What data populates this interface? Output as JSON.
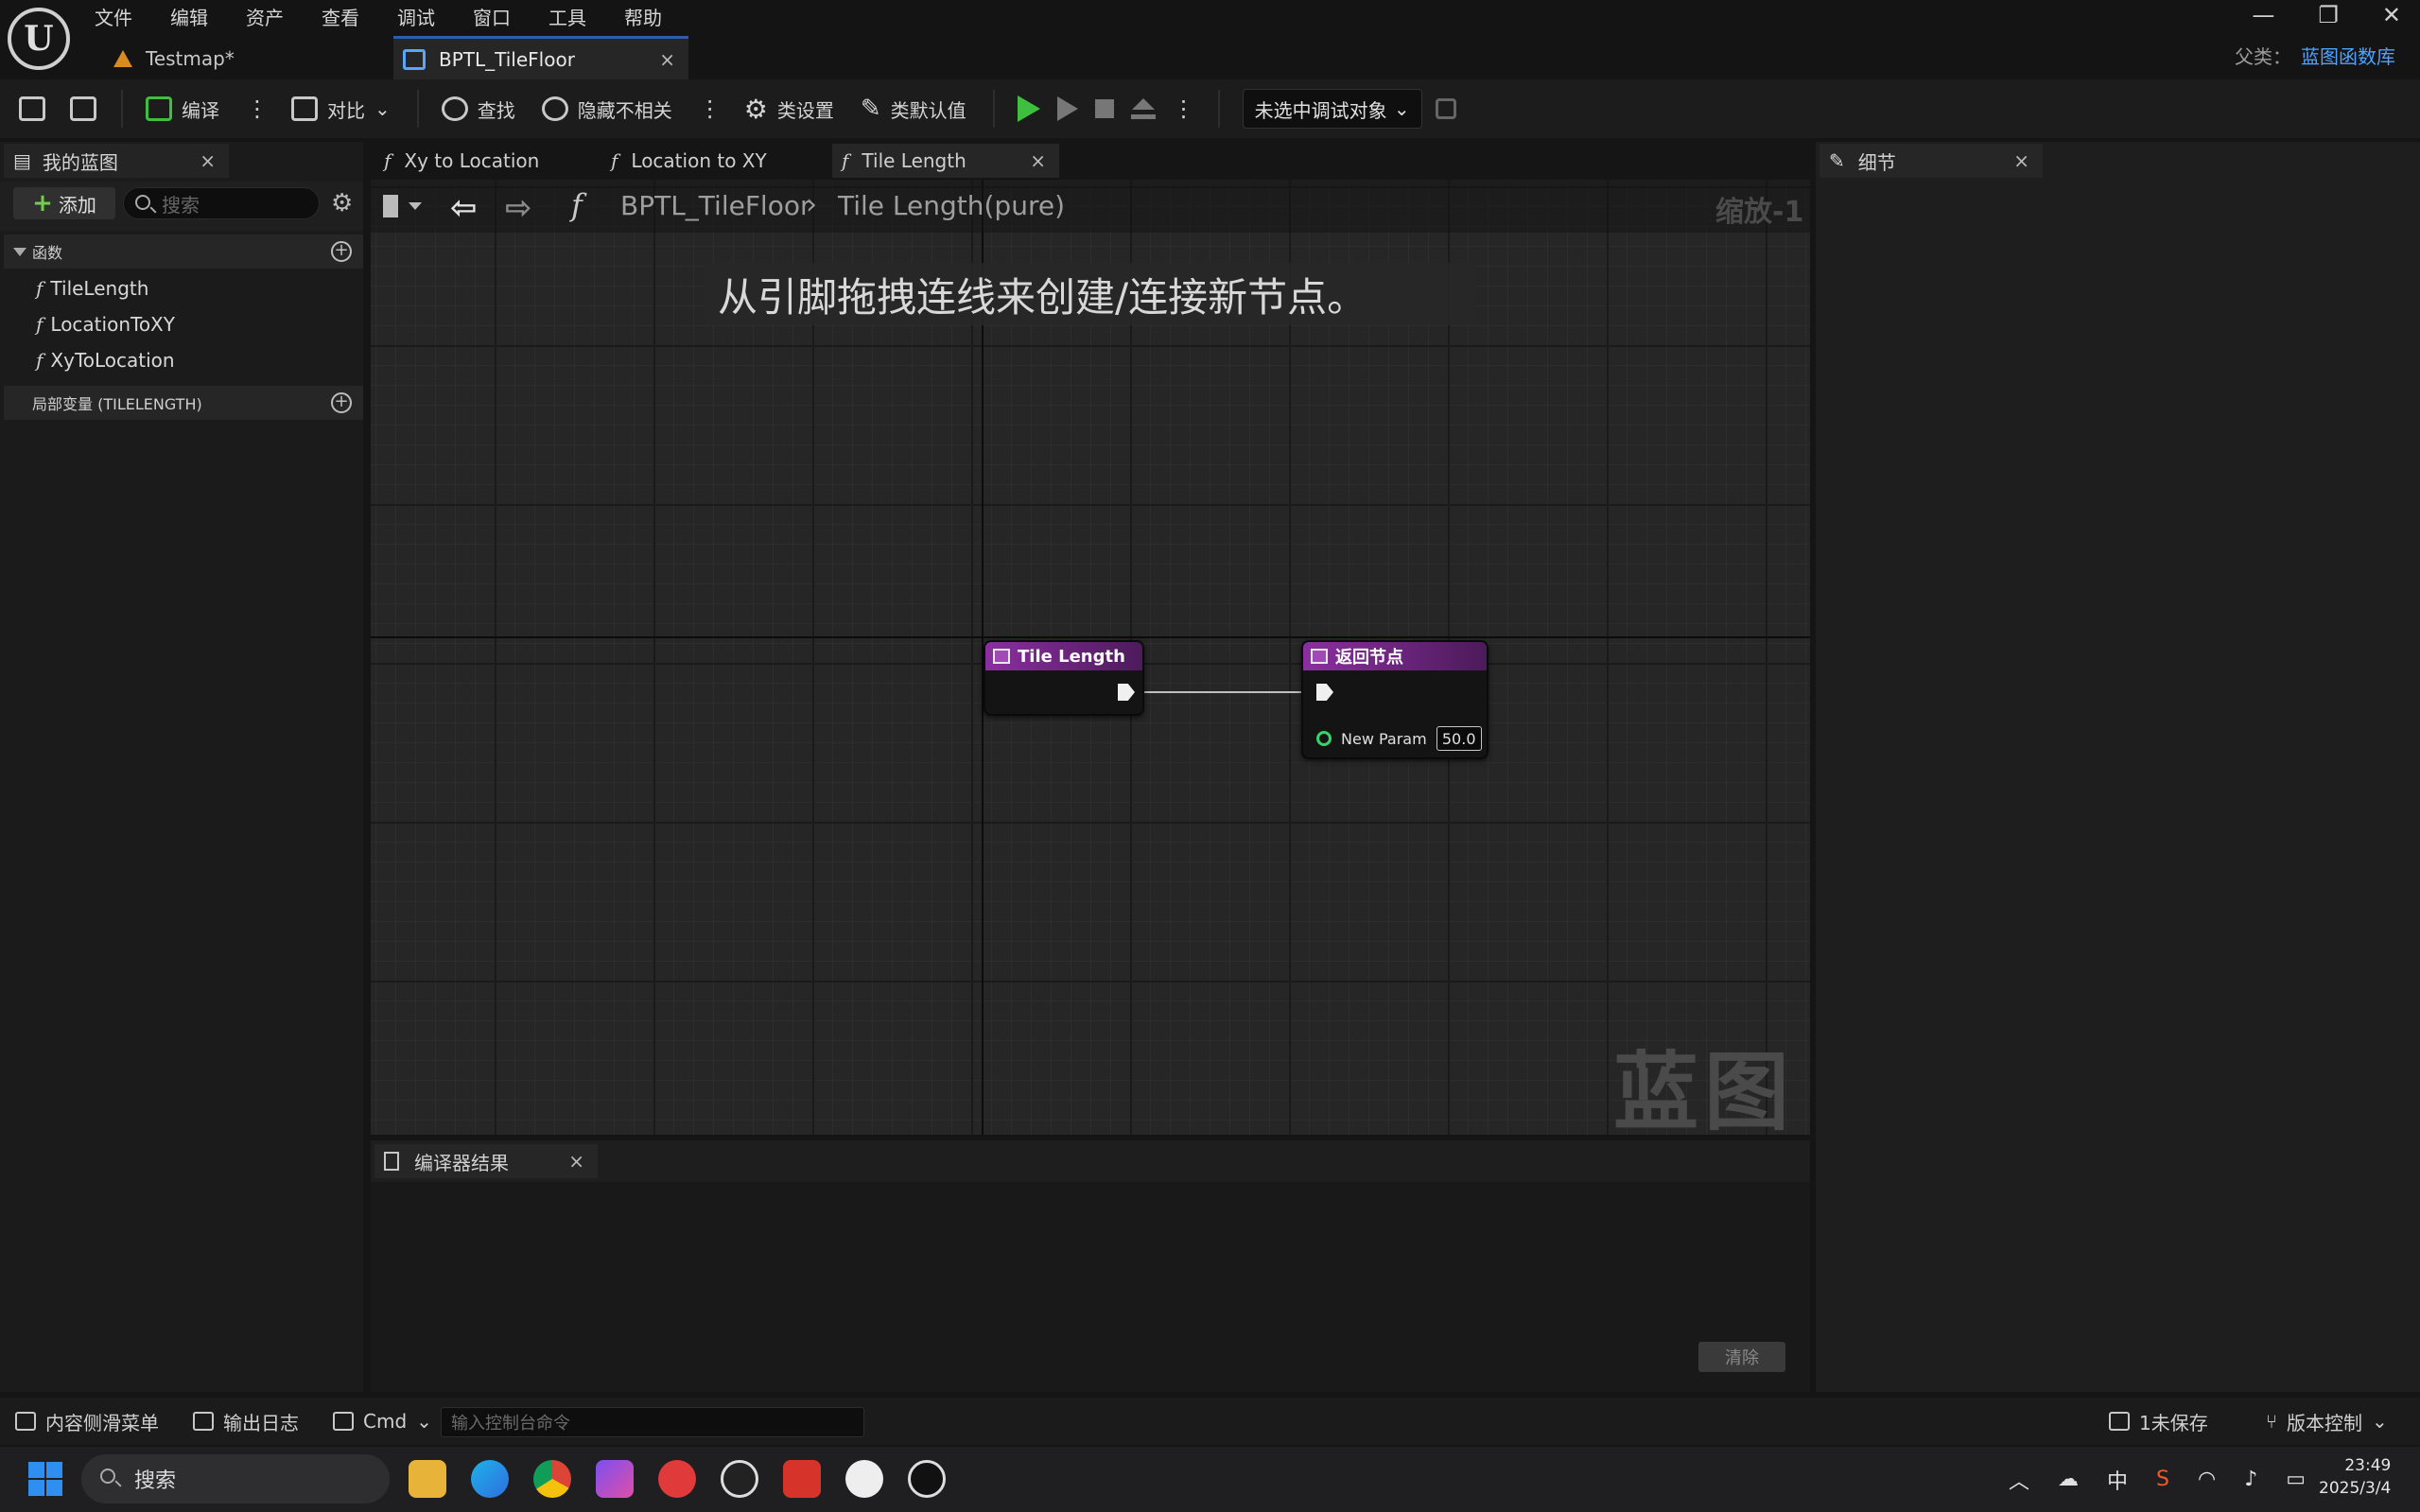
{
  "menu": [
    "文件",
    "编辑",
    "资产",
    "查看",
    "调试",
    "窗口",
    "工具",
    "帮助"
  ],
  "logo_letter": "U",
  "doc_tabs": {
    "map": "Testmap*",
    "blueprint": "BPTL_TileFloor",
    "close": "×"
  },
  "window_controls": {
    "minimize": "—",
    "restore": "❐",
    "close": "✕"
  },
  "parent_class": {
    "label": "父类：",
    "value": "蓝图函数库"
  },
  "toolbar": {
    "compile": "编译",
    "diff": "对比",
    "find": "查找",
    "hide_unrelated": "隐藏不相关",
    "class_settings": "类设置",
    "class_defaults": "类默认值",
    "debug_target": "未选中调试对象"
  },
  "my_blueprint": {
    "tab": "我的蓝图",
    "add": "添加",
    "search_placeholder": "搜索",
    "functions_header": "函数",
    "functions": [
      "TileLength",
      "LocationToXY",
      "XyToLocation"
    ],
    "local_vars_header": "局部变量 (TILELENGTH)"
  },
  "graph_tabs": [
    "Xy to Location",
    "Location to XY",
    "Tile Length"
  ],
  "graph": {
    "breadcrumb_root": "BPTL_TileFloor",
    "breadcrumb_current": "Tile Length(pure)",
    "zoom": "缩放-1",
    "hint": "从引脚拖拽连线来创建/连接新节点。",
    "watermark": "蓝图",
    "entry_node": "Tile Length",
    "return_node": "返回节点",
    "return_param_name": "New Param",
    "return_param_value": "50.0"
  },
  "compiler": {
    "tab": "编译器结果",
    "clear": "清除"
  },
  "details": {
    "tab": "细节"
  },
  "statusbar": {
    "content_drawer": "内容侧滑菜单",
    "output_log": "输出日志",
    "cmd": "Cmd",
    "cmd_placeholder": "输入控制台命令",
    "unsaved": "1未保存",
    "version_control": "版本控制"
  },
  "taskbar": {
    "search": "搜索",
    "ime": "中",
    "time": "23:49",
    "date": "2025/3/4"
  }
}
